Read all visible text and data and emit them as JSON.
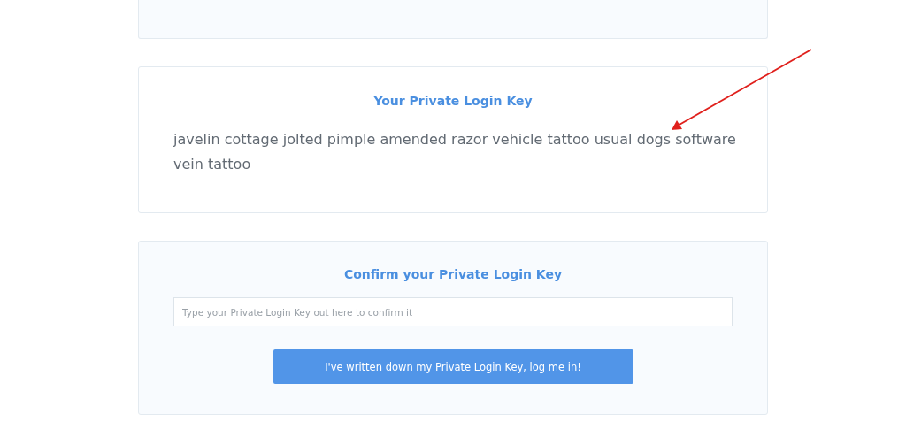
{
  "key_card": {
    "title": "Your Private Login Key",
    "key_text": "javelin cottage jolted pimple amended razor vehicle tattoo usual dogs software vein tattoo"
  },
  "confirm_card": {
    "title": "Confirm your Private Login Key",
    "input": {
      "placeholder": "Type your Private Login Key out here to confirm it"
    },
    "button": "I've written down my Private Login Key, log me in!"
  }
}
